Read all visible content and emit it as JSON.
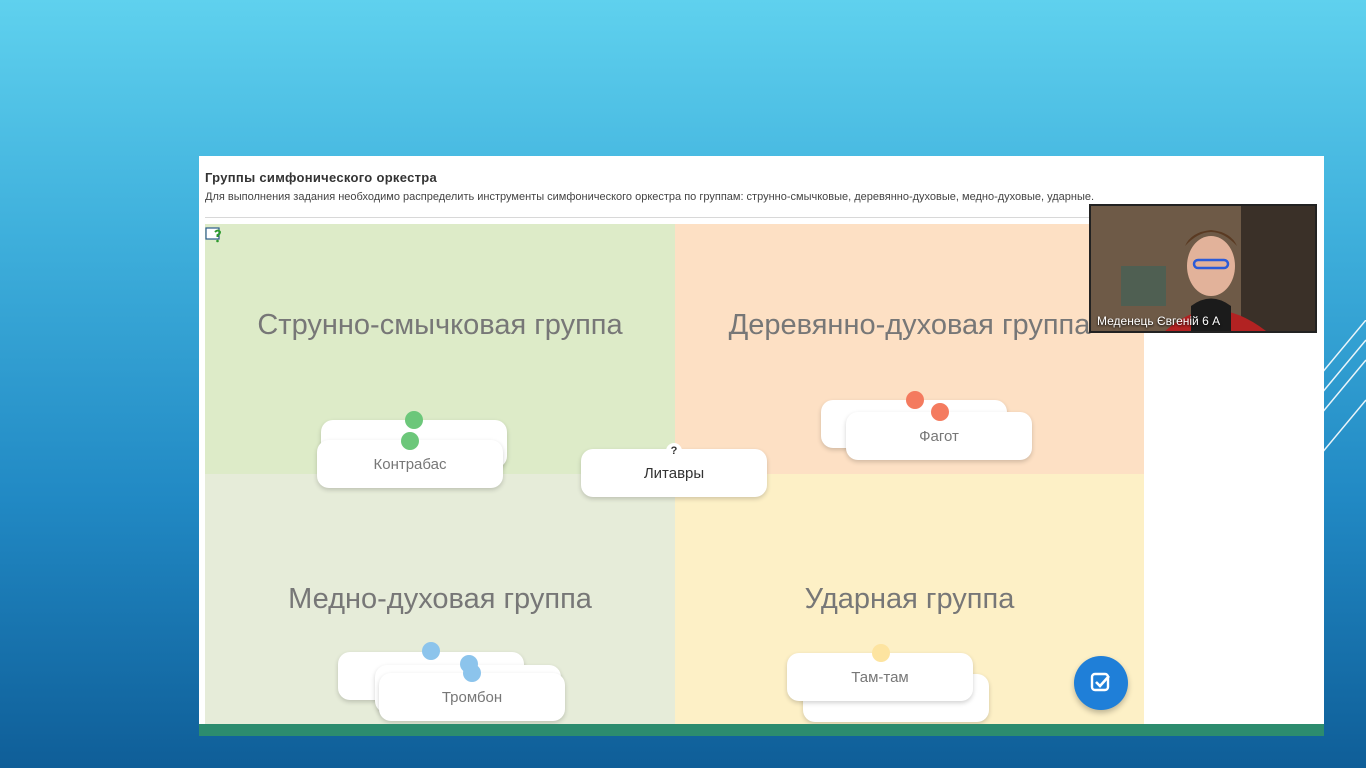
{
  "page": {
    "title": "Группы симфонического оркестра",
    "description": "Для выполнения задания необходимо распределить инструменты симфонического оркестра по группам: струнно-смычковые, деревянно-духовые, медно-духовые, ударные."
  },
  "groups": {
    "strings": "Струнно-смычковая группа",
    "woodwind": "Деревянно-духовая группа",
    "brass": "Медно-духовая группа",
    "percussion": "Ударная группа"
  },
  "cards": {
    "strings_front": "Контрабас",
    "woodwind_front": "Фагот",
    "brass_front": "Тромбон",
    "percussion_front": "Там-там",
    "loose": "Литавры",
    "loose_badge": "?"
  },
  "video": {
    "participant_name": "Меденець Євгеній 6 А"
  },
  "colors": {
    "strings_bg": "#ddebc8",
    "woodwind_bg": "#fde0c4",
    "brass_bg": "#e6ecd9",
    "percussion_bg": "#fdf0c6",
    "check_button": "#1f7fd8"
  },
  "icons": {
    "help": "help-icon",
    "check": "check-icon"
  }
}
